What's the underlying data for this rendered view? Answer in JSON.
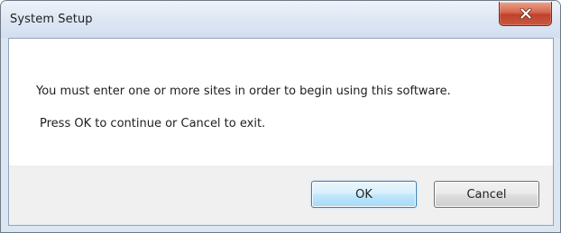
{
  "window": {
    "title": "System Setup"
  },
  "message": {
    "line1": "You must enter one or more sites in order to begin using this software.",
    "line2": "Press OK to continue or Cancel to exit."
  },
  "buttons": {
    "ok_label": "OK",
    "cancel_label": "Cancel"
  },
  "icons": {
    "close": "close-icon"
  },
  "colors": {
    "close_button": "#c7432e",
    "ok_button_border": "#3c7fb1",
    "title_bar": "#dbe6f3",
    "footer": "#f0f0f0"
  }
}
